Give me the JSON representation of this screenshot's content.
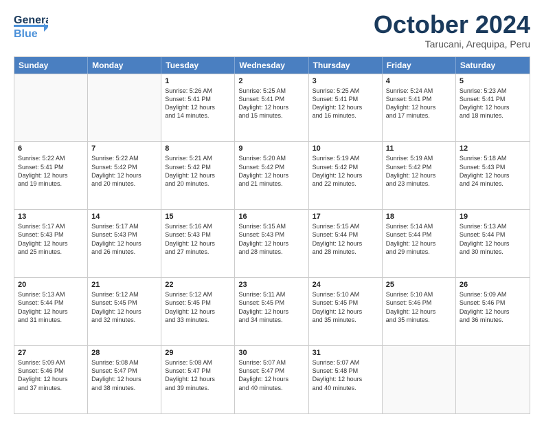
{
  "logo": {
    "line1": "General",
    "line2": "Blue"
  },
  "title": "October 2024",
  "location": "Tarucani, Arequipa, Peru",
  "days_of_week": [
    "Sunday",
    "Monday",
    "Tuesday",
    "Wednesday",
    "Thursday",
    "Friday",
    "Saturday"
  ],
  "weeks": [
    [
      {
        "day": "",
        "empty": true
      },
      {
        "day": "",
        "empty": true
      },
      {
        "day": "1",
        "lines": [
          "Sunrise: 5:26 AM",
          "Sunset: 5:41 PM",
          "Daylight: 12 hours",
          "and 14 minutes."
        ]
      },
      {
        "day": "2",
        "lines": [
          "Sunrise: 5:25 AM",
          "Sunset: 5:41 PM",
          "Daylight: 12 hours",
          "and 15 minutes."
        ]
      },
      {
        "day": "3",
        "lines": [
          "Sunrise: 5:25 AM",
          "Sunset: 5:41 PM",
          "Daylight: 12 hours",
          "and 16 minutes."
        ]
      },
      {
        "day": "4",
        "lines": [
          "Sunrise: 5:24 AM",
          "Sunset: 5:41 PM",
          "Daylight: 12 hours",
          "and 17 minutes."
        ]
      },
      {
        "day": "5",
        "lines": [
          "Sunrise: 5:23 AM",
          "Sunset: 5:41 PM",
          "Daylight: 12 hours",
          "and 18 minutes."
        ]
      }
    ],
    [
      {
        "day": "6",
        "lines": [
          "Sunrise: 5:22 AM",
          "Sunset: 5:41 PM",
          "Daylight: 12 hours",
          "and 19 minutes."
        ]
      },
      {
        "day": "7",
        "lines": [
          "Sunrise: 5:22 AM",
          "Sunset: 5:42 PM",
          "Daylight: 12 hours",
          "and 20 minutes."
        ]
      },
      {
        "day": "8",
        "lines": [
          "Sunrise: 5:21 AM",
          "Sunset: 5:42 PM",
          "Daylight: 12 hours",
          "and 20 minutes."
        ]
      },
      {
        "day": "9",
        "lines": [
          "Sunrise: 5:20 AM",
          "Sunset: 5:42 PM",
          "Daylight: 12 hours",
          "and 21 minutes."
        ]
      },
      {
        "day": "10",
        "lines": [
          "Sunrise: 5:19 AM",
          "Sunset: 5:42 PM",
          "Daylight: 12 hours",
          "and 22 minutes."
        ]
      },
      {
        "day": "11",
        "lines": [
          "Sunrise: 5:19 AM",
          "Sunset: 5:42 PM",
          "Daylight: 12 hours",
          "and 23 minutes."
        ]
      },
      {
        "day": "12",
        "lines": [
          "Sunrise: 5:18 AM",
          "Sunset: 5:43 PM",
          "Daylight: 12 hours",
          "and 24 minutes."
        ]
      }
    ],
    [
      {
        "day": "13",
        "lines": [
          "Sunrise: 5:17 AM",
          "Sunset: 5:43 PM",
          "Daylight: 12 hours",
          "and 25 minutes."
        ]
      },
      {
        "day": "14",
        "lines": [
          "Sunrise: 5:17 AM",
          "Sunset: 5:43 PM",
          "Daylight: 12 hours",
          "and 26 minutes."
        ]
      },
      {
        "day": "15",
        "lines": [
          "Sunrise: 5:16 AM",
          "Sunset: 5:43 PM",
          "Daylight: 12 hours",
          "and 27 minutes."
        ]
      },
      {
        "day": "16",
        "lines": [
          "Sunrise: 5:15 AM",
          "Sunset: 5:43 PM",
          "Daylight: 12 hours",
          "and 28 minutes."
        ]
      },
      {
        "day": "17",
        "lines": [
          "Sunrise: 5:15 AM",
          "Sunset: 5:44 PM",
          "Daylight: 12 hours",
          "and 28 minutes."
        ]
      },
      {
        "day": "18",
        "lines": [
          "Sunrise: 5:14 AM",
          "Sunset: 5:44 PM",
          "Daylight: 12 hours",
          "and 29 minutes."
        ]
      },
      {
        "day": "19",
        "lines": [
          "Sunrise: 5:13 AM",
          "Sunset: 5:44 PM",
          "Daylight: 12 hours",
          "and 30 minutes."
        ]
      }
    ],
    [
      {
        "day": "20",
        "lines": [
          "Sunrise: 5:13 AM",
          "Sunset: 5:44 PM",
          "Daylight: 12 hours",
          "and 31 minutes."
        ]
      },
      {
        "day": "21",
        "lines": [
          "Sunrise: 5:12 AM",
          "Sunset: 5:45 PM",
          "Daylight: 12 hours",
          "and 32 minutes."
        ]
      },
      {
        "day": "22",
        "lines": [
          "Sunrise: 5:12 AM",
          "Sunset: 5:45 PM",
          "Daylight: 12 hours",
          "and 33 minutes."
        ]
      },
      {
        "day": "23",
        "lines": [
          "Sunrise: 5:11 AM",
          "Sunset: 5:45 PM",
          "Daylight: 12 hours",
          "and 34 minutes."
        ]
      },
      {
        "day": "24",
        "lines": [
          "Sunrise: 5:10 AM",
          "Sunset: 5:45 PM",
          "Daylight: 12 hours",
          "and 35 minutes."
        ]
      },
      {
        "day": "25",
        "lines": [
          "Sunrise: 5:10 AM",
          "Sunset: 5:46 PM",
          "Daylight: 12 hours",
          "and 35 minutes."
        ]
      },
      {
        "day": "26",
        "lines": [
          "Sunrise: 5:09 AM",
          "Sunset: 5:46 PM",
          "Daylight: 12 hours",
          "and 36 minutes."
        ]
      }
    ],
    [
      {
        "day": "27",
        "lines": [
          "Sunrise: 5:09 AM",
          "Sunset: 5:46 PM",
          "Daylight: 12 hours",
          "and 37 minutes."
        ]
      },
      {
        "day": "28",
        "lines": [
          "Sunrise: 5:08 AM",
          "Sunset: 5:47 PM",
          "Daylight: 12 hours",
          "and 38 minutes."
        ]
      },
      {
        "day": "29",
        "lines": [
          "Sunrise: 5:08 AM",
          "Sunset: 5:47 PM",
          "Daylight: 12 hours",
          "and 39 minutes."
        ]
      },
      {
        "day": "30",
        "lines": [
          "Sunrise: 5:07 AM",
          "Sunset: 5:47 PM",
          "Daylight: 12 hours",
          "and 40 minutes."
        ]
      },
      {
        "day": "31",
        "lines": [
          "Sunrise: 5:07 AM",
          "Sunset: 5:48 PM",
          "Daylight: 12 hours",
          "and 40 minutes."
        ]
      },
      {
        "day": "",
        "empty": true
      },
      {
        "day": "",
        "empty": true
      }
    ]
  ]
}
